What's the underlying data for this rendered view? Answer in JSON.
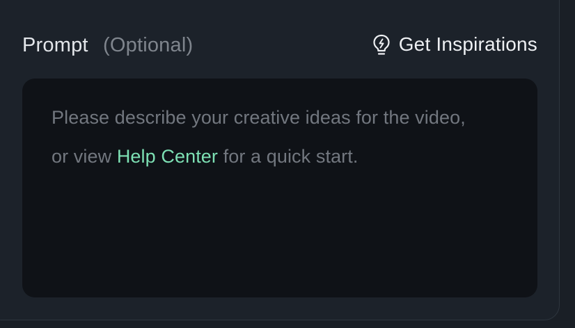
{
  "prompt_section": {
    "label": "Prompt",
    "optional": "(Optional)",
    "inspire_button": {
      "icon": "lightbulb-icon",
      "label": "Get Inspirations"
    },
    "textarea": {
      "placeholder_part1": "Please describe your creative ideas for the video,",
      "placeholder_part2": "or view ",
      "help_link": "Help Center",
      "placeholder_part3": " for a quick start."
    }
  },
  "colors": {
    "panel_bg": "#1c222a",
    "textarea_bg": "#0f1217",
    "link_accent": "#7de0b4",
    "placeholder_text": "#72777f",
    "muted_text": "#7f858d"
  }
}
